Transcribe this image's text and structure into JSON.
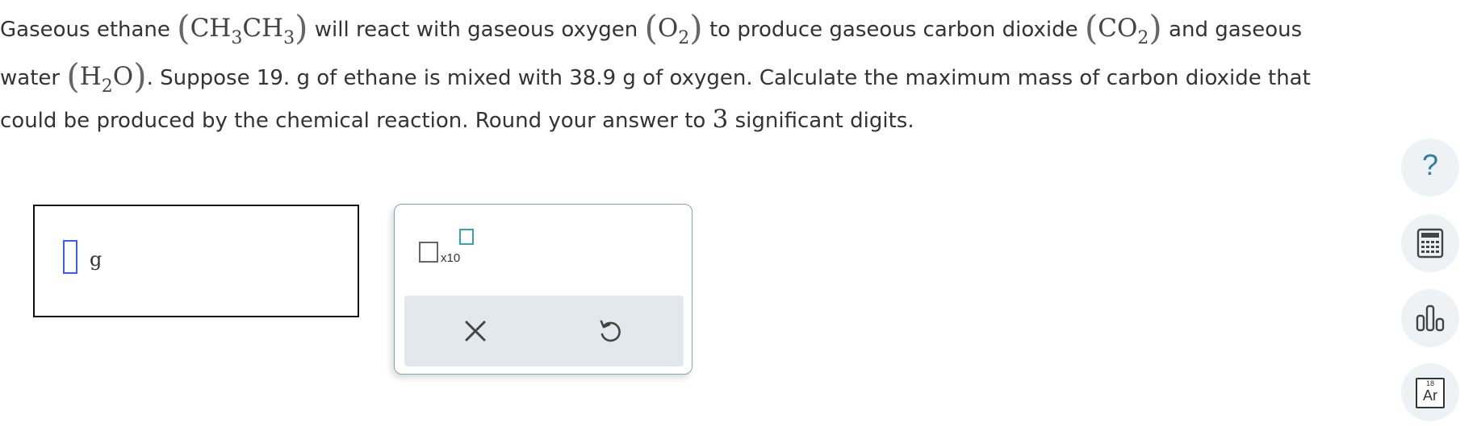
{
  "question": {
    "line1": {
      "t1": "Gaseous ethane ",
      "ethane_a": "CH",
      "ethane_sub_a": "3",
      "ethane_b": "CH",
      "ethane_sub_b": "3",
      "t2": " will react with gaseous oxygen ",
      "oxygen": "O",
      "oxygen_sub": "2",
      "t3": " to produce gaseous carbon dioxide ",
      "co2": "CO",
      "co2_sub": "2",
      "t4": " and gaseous"
    },
    "line2": {
      "t1": "water ",
      "water_a": "H",
      "water_sub": "2",
      "water_b": "O",
      "t2": ". Suppose 19. g of ethane is mixed with 38.9 g of oxygen. Calculate the maximum mass of carbon dioxide that"
    },
    "line3": {
      "t1": "could be produced by the chemical reaction. Round your answer to ",
      "digits": "3",
      "t2": " significant digits."
    }
  },
  "answer": {
    "unit": "g"
  },
  "tools": {
    "x10_label": "x10"
  },
  "colors": {
    "accent": "#3b5bff",
    "toolbar_bg": "#e3e8ec",
    "help": "#2f7fa3"
  },
  "sidebar": {
    "periodic_number": "18",
    "periodic_symbol": "Ar",
    "help_glyph": "?"
  }
}
